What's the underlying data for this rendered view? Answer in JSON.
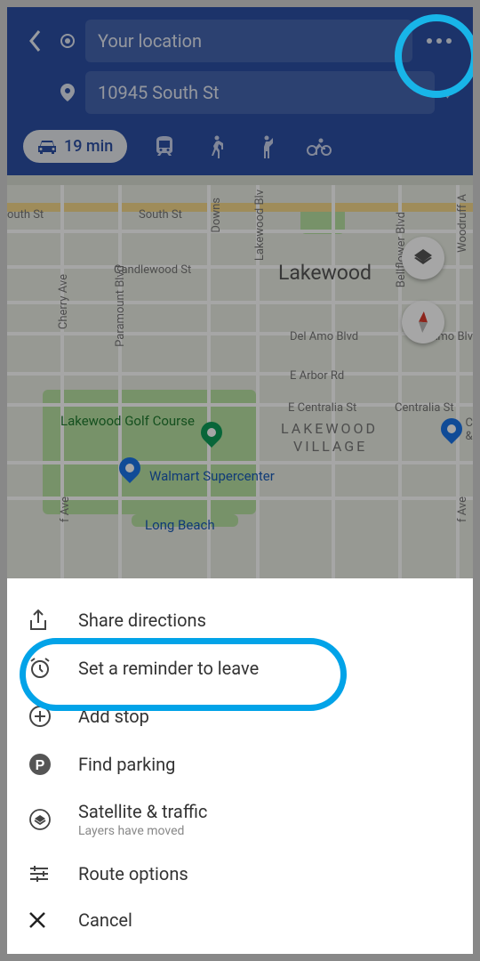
{
  "header": {
    "origin_value": "Your location",
    "destination_value": "10945 South St",
    "selected_mode": "car",
    "selected_duration": "19 min"
  },
  "map": {
    "area_name": "Lakewood",
    "district_line1": "LAKEWOOD",
    "district_line2": "VILLAGE",
    "streets": {
      "outh_st": "outh St",
      "south_st": "South St",
      "candlewood_st": "Candlewood St",
      "del_amo": "Del Amo Blvd",
      "e_arbor": "E Arbor Rd",
      "e_centralia": "E Centralia St",
      "centralia": "Centralia St",
      "long_beach": "Long Beach",
      "cherry_ave": "Cherry Ave",
      "paramount": "Paramount Blvd",
      "downs": "Downs",
      "lakewood_blv": "Lakewood Blv",
      "bellflower": "Bellflower Blvd",
      "woodruff": "Woodruff A",
      "amo_blv": "Amo Blv",
      "f_ave_left": "f Ave",
      "f_ave_right": "f Ave",
      "c_amp": "C\n&"
    },
    "pois": {
      "golf": "Lakewood Golf Course",
      "walmart": "Walmart Supercenter"
    }
  },
  "menu": {
    "share": "Share directions",
    "reminder": "Set a reminder to leave",
    "add_stop": "Add stop",
    "parking": "Find parking",
    "satellite": "Satellite & traffic",
    "satellite_sub": "Layers have moved",
    "route_options": "Route options",
    "cancel": "Cancel"
  }
}
